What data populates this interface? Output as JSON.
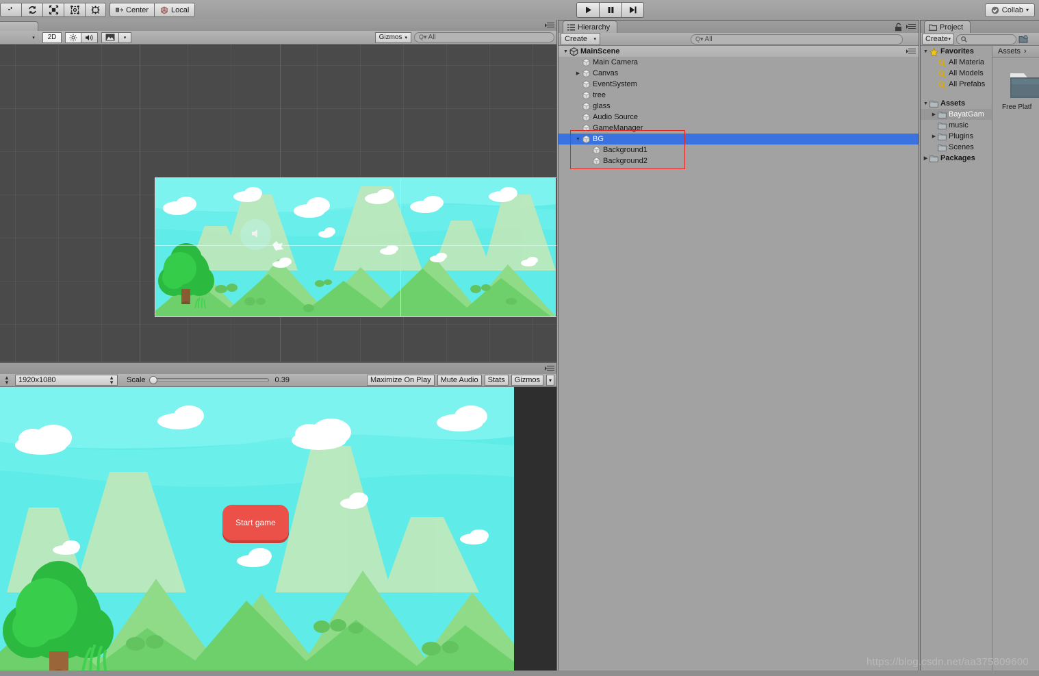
{
  "toolbar": {
    "tools": [
      {
        "name": "hand-tool-icon",
        "glyph": "✋"
      },
      {
        "name": "rotate-tool-icon",
        "glyph": "↻"
      },
      {
        "name": "scale-tool-icon",
        "glyph": "⤡"
      },
      {
        "name": "rect-tool-icon",
        "glyph": "⧉"
      },
      {
        "name": "transform-tool-icon",
        "glyph": "✣"
      }
    ],
    "pivot_label": "Center",
    "rotation_label": "Local",
    "play_label": "▶",
    "pause_label": "▐▐",
    "step_label": "▶|",
    "collab_label": "Collab",
    "collab_arrow": "▾"
  },
  "scene_view": {
    "tab_label": "",
    "draw_mode_arrow": "▾",
    "mode_2d_label": "2D",
    "lighting_icon": "☀",
    "audio_icon": "🔊",
    "fx_icon": "⛰",
    "fx_arrow": "▾",
    "gizmos_label": "Gizmos",
    "gizmos_arrow": "▾",
    "search_placeholder": "All",
    "search_icon": "Q▾"
  },
  "game_view": {
    "resolution": "1920x1080",
    "scale_label": "Scale",
    "scale_value": "0.39",
    "maximize_label": "Maximize On Play",
    "mute_label": "Mute Audio",
    "stats_label": "Stats",
    "gizmos_label": "Gizmos",
    "gizmos_arrow": "▾",
    "start_game_button": "Start game"
  },
  "hierarchy": {
    "tab_label": "Hierarchy",
    "tab_icon": "☷",
    "create_label": "Create",
    "create_arrow": "▾",
    "search_placeholder": "All",
    "search_icon": "Q▾",
    "lock_icon": "🔓",
    "scene_name": "MainScene",
    "items": [
      {
        "label": "Main Camera",
        "depth": 1,
        "expandable": false,
        "expanded": false,
        "selected": false
      },
      {
        "label": "Canvas",
        "depth": 1,
        "expandable": true,
        "expanded": false,
        "selected": false
      },
      {
        "label": "EventSystem",
        "depth": 1,
        "expandable": false,
        "expanded": false,
        "selected": false
      },
      {
        "label": "tree",
        "depth": 1,
        "expandable": false,
        "expanded": false,
        "selected": false
      },
      {
        "label": "glass",
        "depth": 1,
        "expandable": false,
        "expanded": false,
        "selected": false
      },
      {
        "label": "Audio Source",
        "depth": 1,
        "expandable": false,
        "expanded": false,
        "selected": false
      },
      {
        "label": "GameManager",
        "depth": 1,
        "expandable": false,
        "expanded": false,
        "selected": false
      },
      {
        "label": "BG",
        "depth": 1,
        "expandable": true,
        "expanded": true,
        "selected": true
      },
      {
        "label": "Background1",
        "depth": 2,
        "expandable": false,
        "expanded": false,
        "selected": false
      },
      {
        "label": "Background2",
        "depth": 2,
        "expandable": false,
        "expanded": false,
        "selected": false
      }
    ]
  },
  "project": {
    "tab_label": "Project",
    "tab_icon": "🗁",
    "create_label": "Create",
    "create_arrow": "▾",
    "search_placeholder": "",
    "search_icon": "🔍",
    "tree": [
      {
        "label": "Favorites",
        "kind": "star",
        "depth": 0,
        "bold": true,
        "expandable": true,
        "expanded": true,
        "selected": false
      },
      {
        "label": "All Materia",
        "kind": "search",
        "depth": 1,
        "bold": false,
        "expandable": false,
        "expanded": false,
        "selected": false
      },
      {
        "label": "All Models",
        "kind": "search",
        "depth": 1,
        "bold": false,
        "expandable": false,
        "expanded": false,
        "selected": false
      },
      {
        "label": "All Prefabs",
        "kind": "search",
        "depth": 1,
        "bold": false,
        "expandable": false,
        "expanded": false,
        "selected": false
      },
      {
        "label": "",
        "kind": "spacer",
        "depth": 0,
        "bold": false,
        "expandable": false,
        "expanded": false,
        "selected": false
      },
      {
        "label": "Assets",
        "kind": "folder",
        "depth": 0,
        "bold": true,
        "expandable": true,
        "expanded": true,
        "selected": false
      },
      {
        "label": "BayatGam",
        "kind": "folder",
        "depth": 1,
        "bold": false,
        "expandable": true,
        "expanded": false,
        "selected": true
      },
      {
        "label": "music",
        "kind": "folder",
        "depth": 1,
        "bold": false,
        "expandable": false,
        "expanded": false,
        "selected": false
      },
      {
        "label": "Plugins",
        "kind": "folder",
        "depth": 1,
        "bold": false,
        "expandable": true,
        "expanded": false,
        "selected": false
      },
      {
        "label": "Scenes",
        "kind": "folder",
        "depth": 1,
        "bold": false,
        "expandable": false,
        "expanded": false,
        "selected": false
      },
      {
        "label": "Packages",
        "kind": "folder",
        "depth": 0,
        "bold": true,
        "expandable": true,
        "expanded": false,
        "selected": false
      }
    ],
    "breadcrumb_root": "Assets",
    "breadcrumb_sep": "›",
    "asset_label": "Free Platf"
  },
  "watermark": "https://blog.csdn.net/aa375809600",
  "colors": {
    "selection_blue": "#3A72E0",
    "highlight_red": "#E8231B",
    "start_button": "#EC5149",
    "sky_light": "#7FF5F0",
    "sky_mid": "#4FE9E6",
    "hill_green": "#6ED06B",
    "hill_pale": "#B9E6B4",
    "tree_green": "#2CB940",
    "panel_gray": "#A2A2A2",
    "scene_bg": "#4A4A4A",
    "game_letterbox": "#2E2E2E"
  }
}
